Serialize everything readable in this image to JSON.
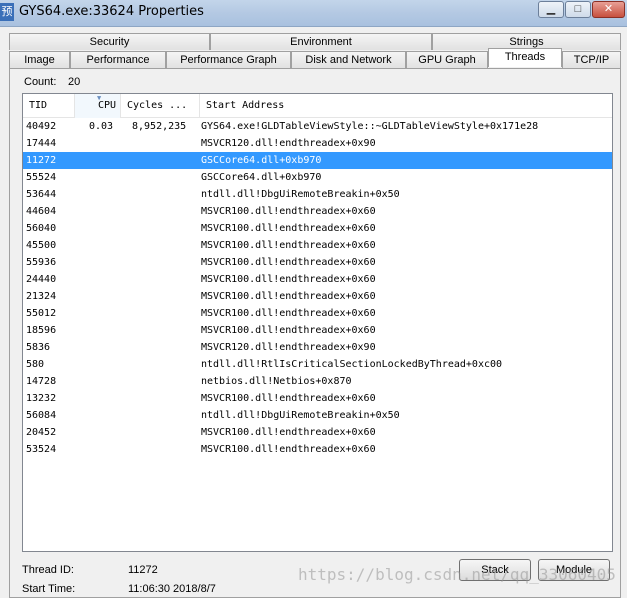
{
  "window": {
    "title": "GYS64.exe:33624 Properties",
    "icon_char": "预",
    "minimize_glyph": "▁",
    "maximize_glyph": "□",
    "close_glyph": "✕"
  },
  "tabs_top": [
    "Security",
    "Environment",
    "Strings"
  ],
  "tabs_bottom": [
    "Image",
    "Performance",
    "Performance Graph",
    "Disk and Network",
    "GPU Graph",
    "Threads",
    "TCP/IP"
  ],
  "active_tab": "Threads",
  "count": {
    "label": "Count:",
    "value": "20"
  },
  "columns": [
    "TID",
    "CPU",
    "Cycles ...",
    "Start Address"
  ],
  "sort_indicator": "▼",
  "selected_row_index": 2,
  "threads": [
    {
      "tid": "40492",
      "cpu": "0.03",
      "cycles": "8,952,235",
      "start": "GYS64.exe!GLDTableViewStyle::~GLDTableViewStyle+0x171e28"
    },
    {
      "tid": "17444",
      "cpu": "",
      "cycles": "",
      "start": "MSVCR120.dll!endthreadex+0x90"
    },
    {
      "tid": "11272",
      "cpu": "",
      "cycles": "",
      "start": "GSCCore64.dll+0xb970"
    },
    {
      "tid": "55524",
      "cpu": "",
      "cycles": "",
      "start": "GSCCore64.dll+0xb970"
    },
    {
      "tid": "53644",
      "cpu": "",
      "cycles": "",
      "start": "ntdll.dll!DbgUiRemoteBreakin+0x50"
    },
    {
      "tid": "44604",
      "cpu": "",
      "cycles": "",
      "start": "MSVCR100.dll!endthreadex+0x60"
    },
    {
      "tid": "56040",
      "cpu": "",
      "cycles": "",
      "start": "MSVCR100.dll!endthreadex+0x60"
    },
    {
      "tid": "45500",
      "cpu": "",
      "cycles": "",
      "start": "MSVCR100.dll!endthreadex+0x60"
    },
    {
      "tid": "55936",
      "cpu": "",
      "cycles": "",
      "start": "MSVCR100.dll!endthreadex+0x60"
    },
    {
      "tid": "24440",
      "cpu": "",
      "cycles": "",
      "start": "MSVCR100.dll!endthreadex+0x60"
    },
    {
      "tid": "21324",
      "cpu": "",
      "cycles": "",
      "start": "MSVCR100.dll!endthreadex+0x60"
    },
    {
      "tid": "55012",
      "cpu": "",
      "cycles": "",
      "start": "MSVCR100.dll!endthreadex+0x60"
    },
    {
      "tid": "18596",
      "cpu": "",
      "cycles": "",
      "start": "MSVCR100.dll!endthreadex+0x60"
    },
    {
      "tid": "5836",
      "cpu": "",
      "cycles": "",
      "start": "MSVCR120.dll!endthreadex+0x90"
    },
    {
      "tid": "580",
      "cpu": "",
      "cycles": "",
      "start": "ntdll.dll!RtlIsCriticalSectionLockedByThread+0xc00"
    },
    {
      "tid": "14728",
      "cpu": "",
      "cycles": "",
      "start": "netbios.dll!Netbios+0x870"
    },
    {
      "tid": "13232",
      "cpu": "",
      "cycles": "",
      "start": "MSVCR100.dll!endthreadex+0x60"
    },
    {
      "tid": "56084",
      "cpu": "",
      "cycles": "",
      "start": "ntdll.dll!DbgUiRemoteBreakin+0x50"
    },
    {
      "tid": "20452",
      "cpu": "",
      "cycles": "",
      "start": "MSVCR100.dll!endthreadex+0x60"
    },
    {
      "tid": "53524",
      "cpu": "",
      "cycles": "",
      "start": "MSVCR100.dll!endthreadex+0x60"
    }
  ],
  "details": {
    "thread_id_label": "Thread ID:",
    "thread_id_value": "11272",
    "start_time_label": "Start Time:",
    "start_time_value": "11:06:30  2018/8/7"
  },
  "buttons": {
    "stack": "Stack",
    "module": "Module"
  },
  "watermark": "https://blog.csdn.net/qq_33060405",
  "colors": {
    "selection": "#3399ff",
    "titlebar": "#b4c9e3",
    "close_button": "#c7503e"
  }
}
